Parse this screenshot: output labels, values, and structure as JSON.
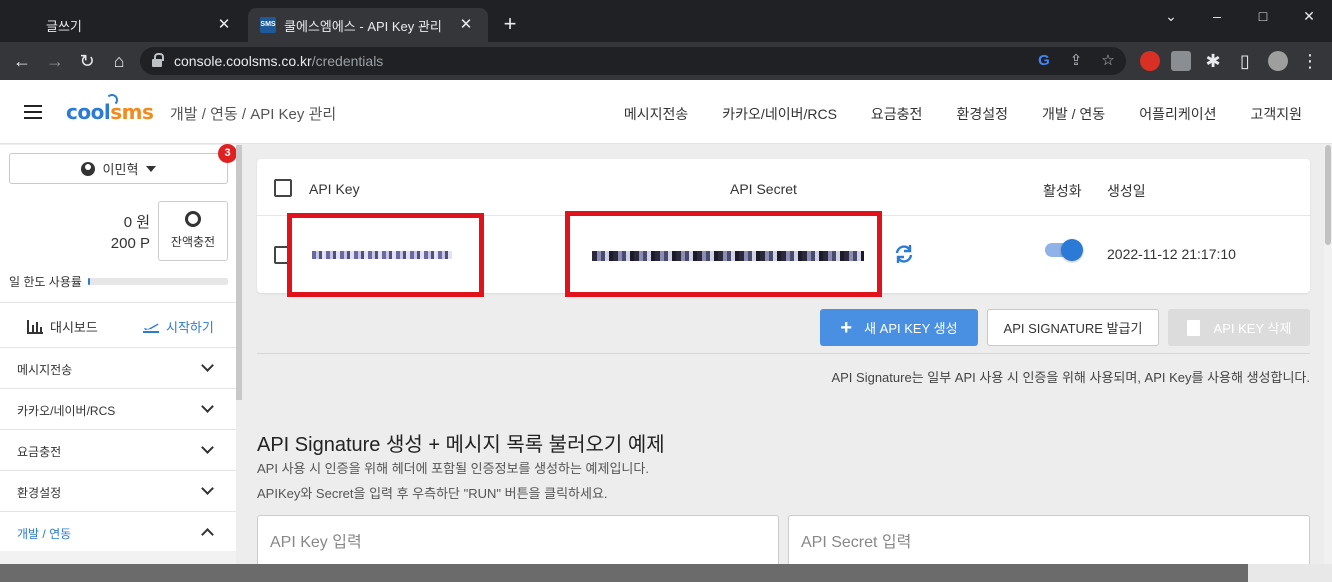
{
  "browser": {
    "tabs": [
      {
        "title": "글쓰기",
        "active": false
      },
      {
        "title": "쿨에스엠에스 - API Key 관리",
        "active": true,
        "favicon_text": "SMS"
      }
    ],
    "url_host": "console.coolsms.co.kr",
    "url_path": "/credentials",
    "window_controls": {
      "minimize": "–",
      "maximize": "□",
      "close": "✕"
    }
  },
  "header": {
    "logo_part1": "cool",
    "logo_part2": "sms",
    "breadcrumb": "개발 / 연동  /  API Key 관리",
    "nav": [
      "메시지전송",
      "카카오/네이버/RCS",
      "요금충전",
      "환경설정",
      "개발 / 연동",
      "어플리케이션",
      "고객지원"
    ]
  },
  "sidebar": {
    "user_name": "이민혁",
    "notification_count": "3",
    "balance_won": "0 원",
    "balance_point": "200 P",
    "charge_label": "잔액충전",
    "limit_label": "일 한도 사용률",
    "limit_usage_fraction": 0.01,
    "dashboard_label": "대시보드",
    "start_label": "시작하기",
    "menu": [
      {
        "label": "메시지전송",
        "expanded": false
      },
      {
        "label": "카카오/네이버/RCS",
        "expanded": false
      },
      {
        "label": "요금충전",
        "expanded": false
      },
      {
        "label": "환경설정",
        "expanded": false
      },
      {
        "label": "개발 / 연동",
        "expanded": true
      }
    ]
  },
  "table": {
    "headers": {
      "api_key": "API Key",
      "api_secret": "API Secret",
      "active": "활성화",
      "created": "생성일"
    },
    "rows": [
      {
        "active": true,
        "created": "2022-11-12 21:17:10"
      }
    ]
  },
  "actions": {
    "create": "새 API KEY 생성",
    "signature": "API SIGNATURE 발급기",
    "delete": "API KEY 삭제"
  },
  "signature_note": "API Signature는 일부 API 사용 시 인증을 위해 사용되며, API Key를 사용해 생성합니다.",
  "example": {
    "title": "API Signature 생성 + 메시지 목록 불러오기 예제",
    "desc1": "API 사용 시 인증을 위해 헤더에 포함될 인증정보를 생성하는 예제입니다.",
    "desc2": "APIKey와 Secret을 입력 후 우측하단 \"RUN\" 버튼을 클릭하세요.",
    "key_placeholder": "API Key 입력",
    "secret_placeholder": "API Secret 입력"
  },
  "colors": {
    "accent": "#2b7bd6",
    "primary_button": "#4a90e2",
    "highlight_box": "#e0121b",
    "badge": "#e02020"
  }
}
